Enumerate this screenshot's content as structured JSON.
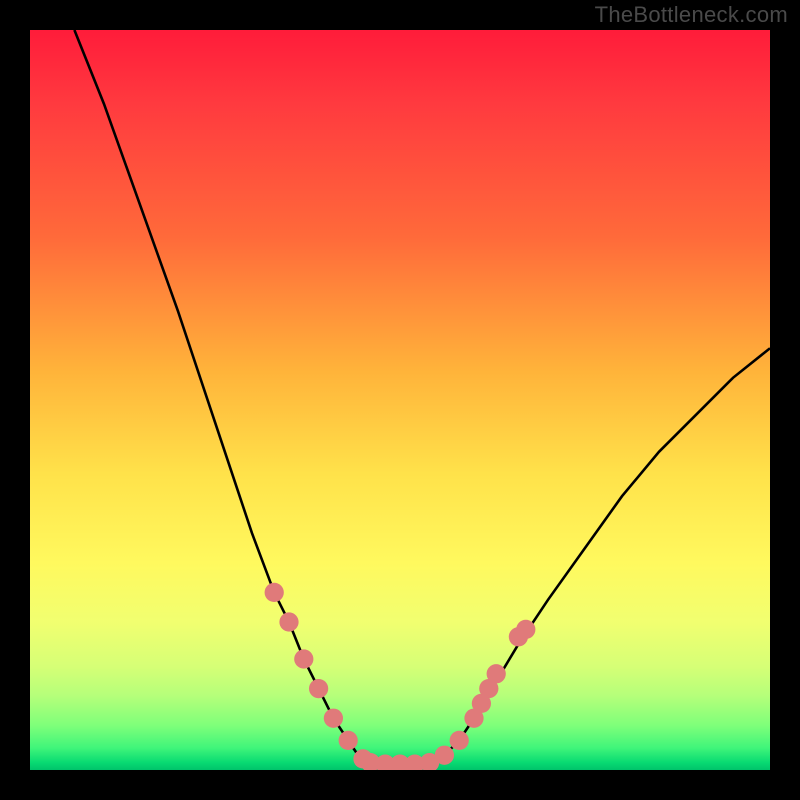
{
  "watermark": "TheBottleneck.com",
  "chart_data": {
    "type": "line",
    "title": "",
    "xlabel": "",
    "ylabel": "",
    "xlim": [
      0,
      100
    ],
    "ylim": [
      0,
      100
    ],
    "grid": false,
    "legend": false,
    "series": [
      {
        "name": "curve",
        "color": "#000000",
        "x": [
          6,
          10,
          15,
          20,
          25,
          28,
          30,
          33,
          35,
          37,
          39,
          41,
          43,
          44,
          45,
          46,
          47,
          48,
          50,
          52,
          54,
          56,
          58,
          60,
          63,
          66,
          70,
          75,
          80,
          85,
          90,
          95,
          100
        ],
        "y": [
          100,
          90,
          76,
          62,
          47,
          38,
          32,
          24,
          20,
          15,
          11,
          7,
          4,
          2.5,
          1.5,
          1,
          0.8,
          0.8,
          0.8,
          0.8,
          1,
          2,
          4,
          7,
          12,
          17,
          23,
          30,
          37,
          43,
          48,
          53,
          57
        ]
      }
    ],
    "markers": [
      {
        "x": 33,
        "y": 24,
        "r": 1.3,
        "color": "#e07a7a"
      },
      {
        "x": 35,
        "y": 20,
        "r": 1.3,
        "color": "#e07a7a"
      },
      {
        "x": 37,
        "y": 15,
        "r": 1.3,
        "color": "#e07a7a"
      },
      {
        "x": 39,
        "y": 11,
        "r": 1.3,
        "color": "#e07a7a"
      },
      {
        "x": 41,
        "y": 7,
        "r": 1.3,
        "color": "#e07a7a"
      },
      {
        "x": 43,
        "y": 4,
        "r": 1.3,
        "color": "#e07a7a"
      },
      {
        "x": 45,
        "y": 1.5,
        "r": 1.3,
        "color": "#e07a7a"
      },
      {
        "x": 46,
        "y": 1,
        "r": 1.3,
        "color": "#e07a7a"
      },
      {
        "x": 48,
        "y": 0.8,
        "r": 1.3,
        "color": "#e07a7a"
      },
      {
        "x": 50,
        "y": 0.8,
        "r": 1.3,
        "color": "#e07a7a"
      },
      {
        "x": 52,
        "y": 0.8,
        "r": 1.3,
        "color": "#e07a7a"
      },
      {
        "x": 54,
        "y": 1,
        "r": 1.3,
        "color": "#e07a7a"
      },
      {
        "x": 56,
        "y": 2,
        "r": 1.3,
        "color": "#e07a7a"
      },
      {
        "x": 58,
        "y": 4,
        "r": 1.3,
        "color": "#e07a7a"
      },
      {
        "x": 60,
        "y": 7,
        "r": 1.3,
        "color": "#e07a7a"
      },
      {
        "x": 61,
        "y": 9,
        "r": 1.3,
        "color": "#e07a7a"
      },
      {
        "x": 62,
        "y": 11,
        "r": 1.3,
        "color": "#e07a7a"
      },
      {
        "x": 63,
        "y": 13,
        "r": 1.3,
        "color": "#e07a7a"
      },
      {
        "x": 66,
        "y": 18,
        "r": 1.3,
        "color": "#e07a7a"
      },
      {
        "x": 67,
        "y": 19,
        "r": 1.3,
        "color": "#e07a7a"
      }
    ],
    "background": {
      "type": "vertical-gradient",
      "stops": [
        {
          "pos": 0,
          "color": "#ff1c3a"
        },
        {
          "pos": 50,
          "color": "#ffcc3a"
        },
        {
          "pos": 80,
          "color": "#f1ff70"
        },
        {
          "pos": 100,
          "color": "#00c36b"
        }
      ]
    }
  }
}
